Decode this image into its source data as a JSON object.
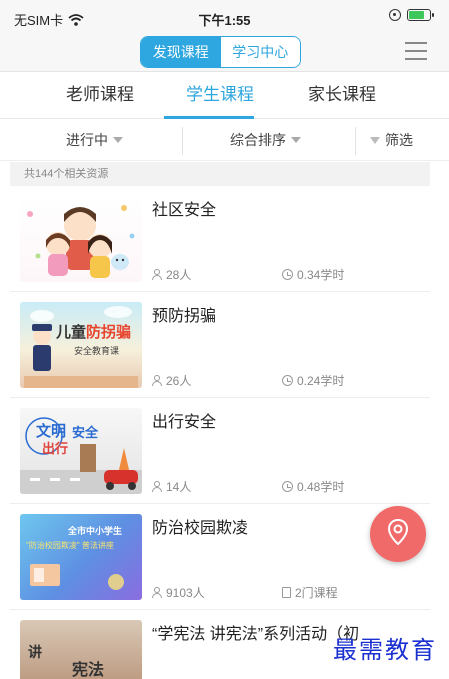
{
  "status_bar": {
    "carrier": "无SIM卡",
    "time": "下午1:55"
  },
  "header": {
    "segments": [
      "发现课程",
      "学习中心"
    ]
  },
  "category_tabs": [
    "老师课程",
    "学生课程",
    "家长课程"
  ],
  "filters": {
    "status": "进行中",
    "sort": "综合排序",
    "filter": "筛选"
  },
  "result_count": "共144个相关资源",
  "courses": [
    {
      "title": "社区安全",
      "people": "28人",
      "extra": "0.34学时",
      "extra_icon": "clock-icon"
    },
    {
      "title": "预防拐骗",
      "people": "26人",
      "extra": "0.24学时",
      "extra_icon": "clock-icon",
      "thumb_text": [
        "儿童",
        "防拐骗",
        "安全教育课"
      ]
    },
    {
      "title": "出行安全",
      "people": "14人",
      "extra": "0.48学时",
      "extra_icon": "clock-icon",
      "thumb_text": [
        "文明",
        "出行",
        "安全"
      ]
    },
    {
      "title": "防治校园欺凌",
      "people": "9103人",
      "extra": "2门课程",
      "extra_icon": "doc-icon",
      "thumb_text": [
        "全市中小学生",
        "\"防治校园欺凌\" 普法讲座"
      ]
    },
    {
      "title": "“学宪法  讲宪法”系列活动（初",
      "thumb_text": [
        "讲",
        "宪法"
      ]
    }
  ],
  "watermark": "最需教育",
  "colors": {
    "accent": "#2ea6df",
    "fab": "#f06a6a",
    "watermark": "#1a30d0"
  }
}
